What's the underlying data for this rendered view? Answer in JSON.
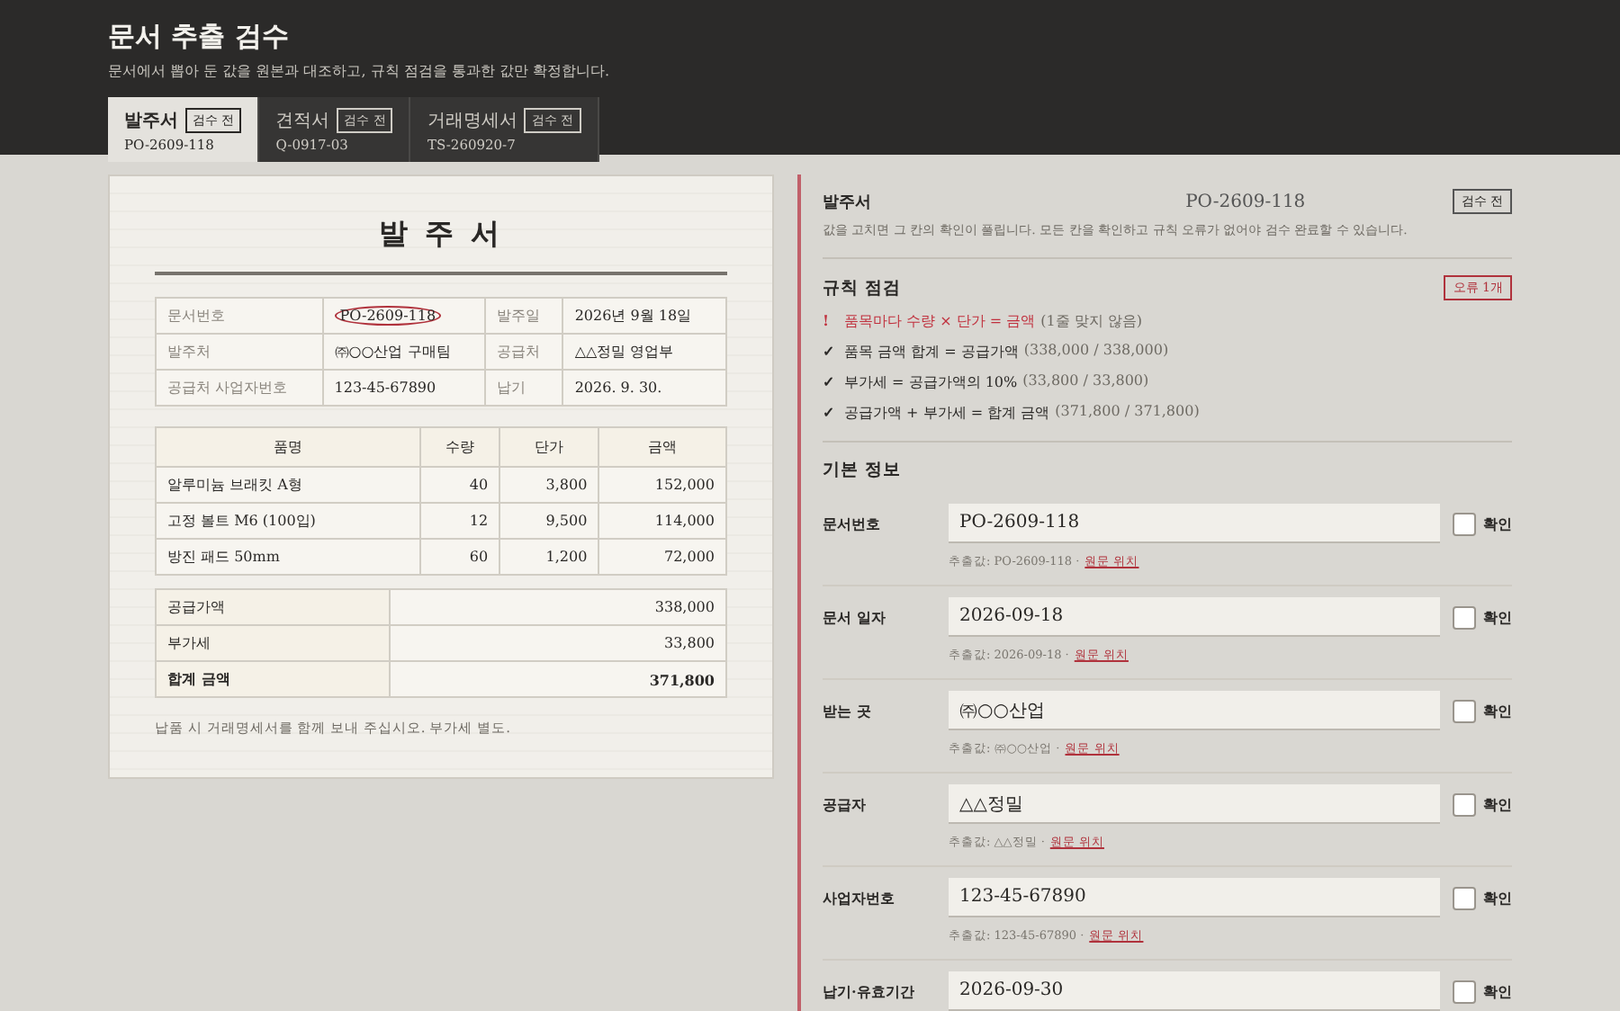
{
  "header": {
    "title": "문서 추출 검수",
    "subtitle": "문서에서 뽑아 둔 값을 원본과 대조하고, 규칙 점검을 통과한 값만 확정합니다."
  },
  "tabs": [
    {
      "label": "발주서",
      "badge": "검수 전",
      "code": "PO-2609-118",
      "selected": true
    },
    {
      "label": "견적서",
      "badge": "검수 전",
      "code": "Q-0917-03",
      "selected": false
    },
    {
      "label": "거래명세서",
      "badge": "검수 전",
      "code": "TS-260920-7",
      "selected": false
    }
  ],
  "document": {
    "title": "발 주 서",
    "meta": [
      [
        {
          "label": "문서번호",
          "value": "PO-2609-118",
          "highlighted": true
        },
        {
          "label": "발주일",
          "value": "2026년 9월 18일",
          "highlighted": false
        }
      ],
      [
        {
          "label": "발주처",
          "value": "㈜○○산업 구매팀",
          "highlighted": false
        },
        {
          "label": "공급처",
          "value": "△△정밀 영업부",
          "highlighted": false
        }
      ],
      [
        {
          "label": "공급처 사업자번호",
          "value": "123-45-67890",
          "highlighted": false
        },
        {
          "label": "납기",
          "value": "2026. 9. 30.",
          "highlighted": false
        }
      ]
    ],
    "columns": [
      "품명",
      "수량",
      "단가",
      "금액"
    ],
    "rows": [
      [
        "알루미늄 브래킷 A형",
        "40",
        "3,800",
        "152,000"
      ],
      [
        "고정 볼트 M6 (100입)",
        "12",
        "9,500",
        "114,000"
      ],
      [
        "방진 패드 50mm",
        "60",
        "1,200",
        "72,000"
      ]
    ],
    "totals": [
      {
        "label": "공급가액",
        "value": "338,000",
        "bold": false
      },
      {
        "label": "부가세",
        "value": "33,800",
        "bold": false
      },
      {
        "label": "합계 금액",
        "value": "371,800",
        "bold": true
      }
    ],
    "note": "납품 시 거래명세서를 함께 보내 주십시오. 부가세 별도."
  },
  "review": {
    "doc_type": "발주서",
    "doc_number": "PO-2609-118",
    "status": "검수 전",
    "description": "값을 고치면 그 칸의 확인이 풀립니다. 모든 칸을 확인하고 규칙 오류가 없어야 검수 완료할 수 있습니다.",
    "rules_title": "규칙 점검",
    "rules_badge": "오류 1개",
    "rules": [
      {
        "kind": "error",
        "mark": "!",
        "text": "품목마다 수량 × 단가 = 금액",
        "detail": "(1줄 맞지 않음)"
      },
      {
        "kind": "ok",
        "mark": "✓",
        "text": "품목 금액 합계 = 공급가액",
        "detail": "(338,000 / 338,000)"
      },
      {
        "kind": "ok",
        "mark": "✓",
        "text": "부가세 = 공급가액의 10%",
        "detail": "(33,800 / 33,800)"
      },
      {
        "kind": "ok",
        "mark": "✓",
        "text": "공급가액 + 부가세 = 합계 금액",
        "detail": "(371,800 / 371,800)"
      }
    ],
    "section_title": "기본 정보",
    "fields": [
      {
        "label": "문서번호",
        "value": "PO-2609-118",
        "extracted": "추출값: PO-2609-118 ·",
        "link": "원문 위치",
        "confirm": "확인",
        "checked": false
      },
      {
        "label": "문서 일자",
        "value": "2026-09-18",
        "extracted": "추출값: 2026-09-18 ·",
        "link": "원문 위치",
        "confirm": "확인",
        "checked": false
      },
      {
        "label": "받는 곳",
        "value": "㈜○○산업",
        "extracted": "추출값: ㈜○○산업 ·",
        "link": "원문 위치",
        "confirm": "확인",
        "checked": false
      },
      {
        "label": "공급자",
        "value": "△△정밀",
        "extracted": "추출값: △△정밀 ·",
        "link": "원문 위치",
        "confirm": "확인",
        "checked": false
      },
      {
        "label": "사업자번호",
        "value": "123-45-67890",
        "extracted": "추출값: 123-45-67890 ·",
        "link": "원문 위치",
        "confirm": "확인",
        "checked": false
      },
      {
        "label": "납기·유효기간",
        "value": "2026-09-30",
        "confirm": "확인",
        "checked": false
      }
    ]
  }
}
